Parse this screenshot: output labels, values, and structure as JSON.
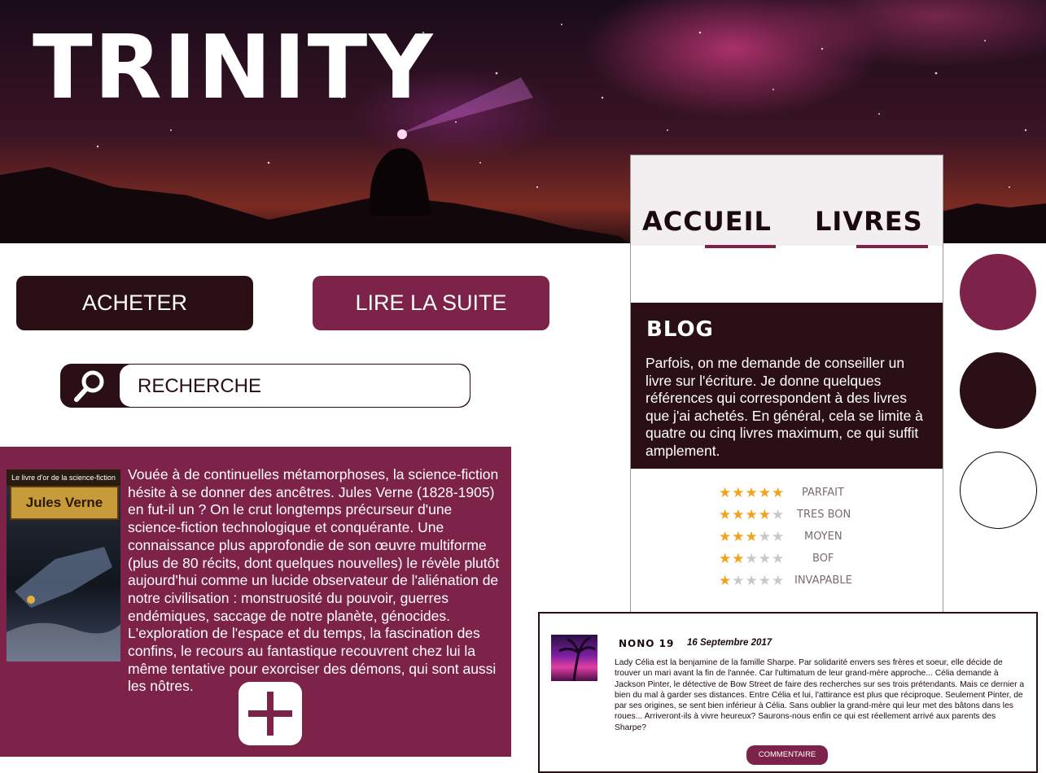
{
  "header": {
    "brand": "TRINITY"
  },
  "nav": {
    "items": [
      {
        "label": "ACCUEIL"
      },
      {
        "label": "LIVRES"
      }
    ]
  },
  "actions": {
    "buy_label": "ACHETER",
    "read_more_label": "LIRE LA SUITE"
  },
  "search": {
    "placeholder": "RECHERCHE",
    "icon": "search-icon"
  },
  "article": {
    "cover": {
      "series": "Le livre d'or de la science-fiction",
      "author": "Jules Verne"
    },
    "text": "Vouée à de continuelles métamorphoses, la science-fiction hésite à se donner des ancêtres. Jules Verne (1828-1905) en fut-il un ? On le crut longtemps précurseur d'une science-fiction technologique et conquérante. Une connaissance plus approfondie de son œuvre multiforme (plus de 80 récits, dont quelques nouvelles) le révèle plutôt aujourd'hui comme un lucide observateur de l'aliénation de notre civilisation : monstruosité du pouvoir, guerres endémiques, saccage de notre planète, génocides. L'exploration de l'espace et du temps, la fascination des confins, le recours au fantastique recouvrent chez lui la même tentative pour exorciser des démons, qui sont aussi les nôtres.",
    "add_icon": "plus-icon"
  },
  "blog": {
    "title": "BLOG",
    "text": "Parfois, on me demande de conseiller un livre sur l'écriture. Je donne quelques références qui correspondent à des livres que j'ai achetés. En général, cela se limite à quatre ou cinq livres maximum, ce qui suffit amplement."
  },
  "ratings": [
    {
      "stars": 5,
      "label": "PARFAIT"
    },
    {
      "stars": 4,
      "label": "TRES BON"
    },
    {
      "stars": 3,
      "label": "MOYEN"
    },
    {
      "stars": 2,
      "label": "BOF"
    },
    {
      "stars": 1,
      "label": "INVAPABLE"
    }
  ],
  "palette": {
    "primary": "#7d2248",
    "dark": "#2a0f14",
    "light": "#ffffff"
  },
  "comment": {
    "author": "NONO 19",
    "date": "16 Septembre 2017",
    "text": "Lady Célia est la benjamine de la famille Sharpe. Par solidarité envers ses frères et soeur, elle décide de trouver un mari avant la fin de l'année. Car l'ultimatum de leur grand-mère approche... Célia demande à Jackson Pinter, le détective de Bow Street de faire des recherches sur ses trois prétendants. Mais ce dernier a bien du mal à garder ses distances. Entre Célia et lui, l'attirance est plus que réciproque. Seulement Pinter, de par ses origines, se sent bien inférieur à Célia. Sans oublier la grand-mère qui leur met des bâtons dans les roues... Arriveront-ils à vivre heureux? Saurons-nous enfin ce qui est réellement arrivé aux parents des Sharpe?",
    "button_label": "COMMENTAIRE"
  }
}
